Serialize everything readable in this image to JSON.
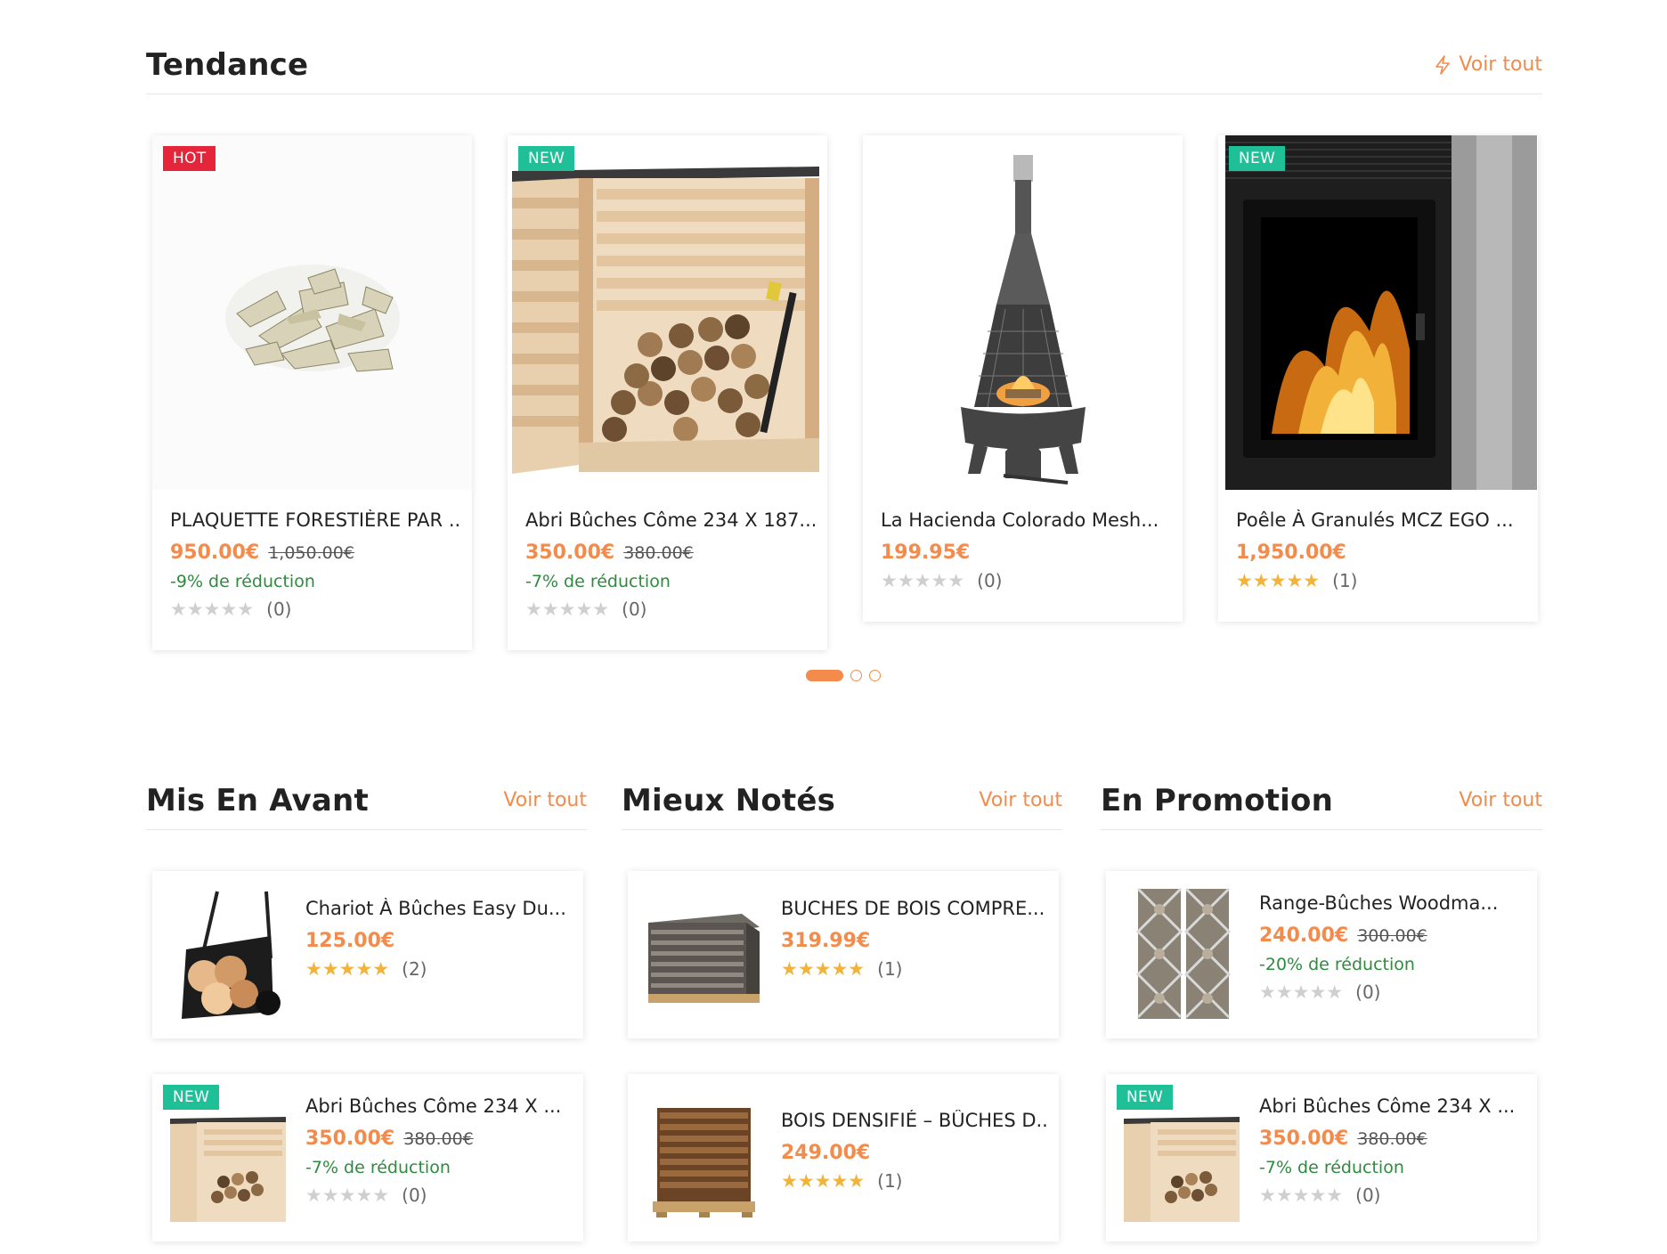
{
  "trending": {
    "title": "Tendance",
    "see_all": "Voir tout",
    "products": [
      {
        "badge": "HOT",
        "name": "PLAQUETTE FORESTIÈRE PAR ...",
        "price": "950.00€",
        "old_price": "1,050.00€",
        "discount": "-9% de réduction",
        "stars": "★★★★★",
        "rating_count": "(0)"
      },
      {
        "badge": "NEW",
        "name": "Abri Bûches Côme 234 X 187...",
        "price": "350.00€",
        "old_price": "380.00€",
        "discount": "-7% de réduction",
        "stars": "★★★★★",
        "rating_count": "(0)"
      },
      {
        "badge": "",
        "name": "La Hacienda Colorado Mesh...",
        "price": "199.95€",
        "old_price": "",
        "discount": "",
        "stars": "★★★★★",
        "rating_count": "(0)"
      },
      {
        "badge": "NEW",
        "name": "Poêle À Granulés MCZ EGO ...",
        "price": "1,950.00€",
        "old_price": "",
        "discount": "",
        "stars": "★★★★★",
        "rating_count": "(1)"
      }
    ]
  },
  "featured": {
    "title": "Mis En Avant",
    "see_all": "Voir tout",
    "products": [
      {
        "badge": "",
        "name": "Chariot À Bûches Easy Du...",
        "price": "125.00€",
        "stars": "★★★★★",
        "rating_count": "(2)"
      },
      {
        "badge": "NEW",
        "name": "Abri Bûches Côme 234 X ...",
        "price": "350.00€",
        "old_price": "380.00€",
        "discount": "-7% de réduction",
        "stars": "★★★★★",
        "rating_count": "(0)"
      }
    ]
  },
  "top_rated": {
    "title": "Mieux Notés",
    "see_all": "Voir tout",
    "products": [
      {
        "name": "BUCHES DE BOIS COMPRE...",
        "price": "319.99€",
        "stars": "★★★★★",
        "rating_count": "(1)"
      },
      {
        "name": "BOIS DENSIFIÉ – BÛCHES D...",
        "price": "249.00€",
        "stars": "★★★★★",
        "rating_count": "(1)"
      }
    ]
  },
  "on_sale": {
    "title": "En Promotion",
    "see_all": "Voir tout",
    "products": [
      {
        "badge": "",
        "name": "Range-Bûches Woodma...",
        "price": "240.00€",
        "old_price": "300.00€",
        "discount": "-20% de réduction",
        "stars": "★★★★★",
        "rating_count": "(0)"
      },
      {
        "badge": "NEW",
        "name": "Abri Bûches Côme 234 X ...",
        "price": "350.00€",
        "old_price": "380.00€",
        "discount": "-7% de réduction",
        "stars": "★★★★★",
        "rating_count": "(0)"
      }
    ]
  },
  "colors": {
    "accent": "#f28b4b",
    "hot": "#e4253a",
    "new": "#1fbf98",
    "discount": "#2e8b3e",
    "star": "#f1b33b"
  },
  "carousel": {
    "pages": 3,
    "active_page": 1
  }
}
